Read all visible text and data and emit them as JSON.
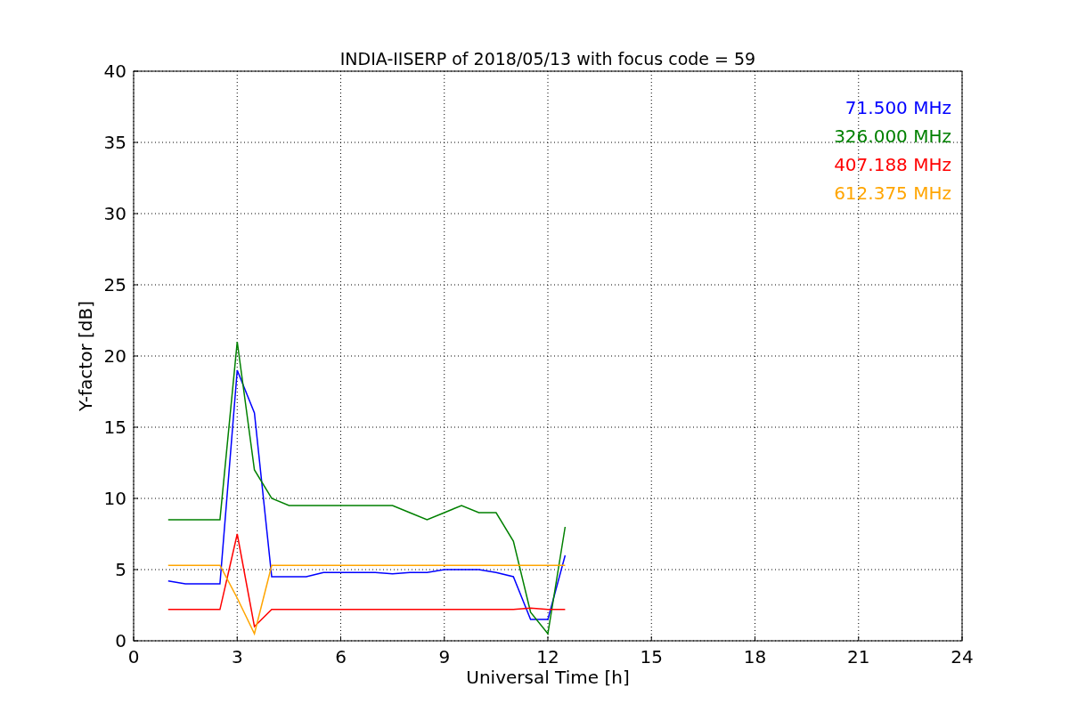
{
  "figure": {
    "chart_data": {
      "type": "line",
      "title": "INDIA-IISERP of 2018/05/13 with focus code = 59",
      "xlabel": "Universal Time [h]",
      "ylabel": "Y-factor [dB]",
      "x": [
        1,
        1.5,
        2,
        2.5,
        3,
        3.5,
        4,
        4.5,
        5,
        5.5,
        6,
        6.5,
        7,
        7.5,
        8,
        8.5,
        9,
        9.5,
        10,
        10.5,
        11,
        11.5,
        12,
        12.5
      ],
      "series": [
        {
          "name": "71.500 MHz",
          "color": "#0000ff",
          "values": [
            4.2,
            4,
            4,
            4,
            19,
            16,
            4.5,
            4.5,
            4.5,
            4.8,
            4.8,
            4.8,
            4.8,
            4.7,
            4.8,
            4.8,
            5,
            5,
            5,
            4.8,
            4.5,
            1.5,
            1.5,
            6
          ]
        },
        {
          "name": "326.000 MHz",
          "color": "#008000",
          "values": [
            8.5,
            8.5,
            8.5,
            8.5,
            21,
            12,
            10,
            9.5,
            9.5,
            9.5,
            9.5,
            9.5,
            9.5,
            9.5,
            9,
            8.5,
            9,
            9.5,
            9,
            9,
            7,
            2,
            0.5,
            8
          ]
        },
        {
          "name": "407.188 MHz",
          "color": "#ff0000",
          "values": [
            2.2,
            2.2,
            2.2,
            2.2,
            7.5,
            1,
            2.2,
            2.2,
            2.2,
            2.2,
            2.2,
            2.2,
            2.2,
            2.2,
            2.2,
            2.2,
            2.2,
            2.2,
            2.2,
            2.2,
            2.2,
            2.3,
            2.2,
            2.2
          ]
        },
        {
          "name": "612.375 MHz",
          "color": "#ffa500",
          "values": [
            5.3,
            5.3,
            5.3,
            5.3,
            3,
            0.5,
            5.3,
            5.3,
            5.3,
            5.3,
            5.3,
            5.3,
            5.3,
            5.3,
            5.3,
            5.3,
            5.3,
            5.3,
            5.3,
            5.3,
            5.3,
            5.3,
            5.3,
            5.3
          ]
        }
      ],
      "grid": true,
      "xlim": [
        0,
        24
      ],
      "ylim": [
        0,
        40
      ],
      "xticks": [
        0,
        3,
        6,
        9,
        12,
        15,
        18,
        21,
        24
      ],
      "yticks": [
        0,
        5,
        10,
        15,
        20,
        25,
        30,
        35,
        40
      ]
    }
  }
}
